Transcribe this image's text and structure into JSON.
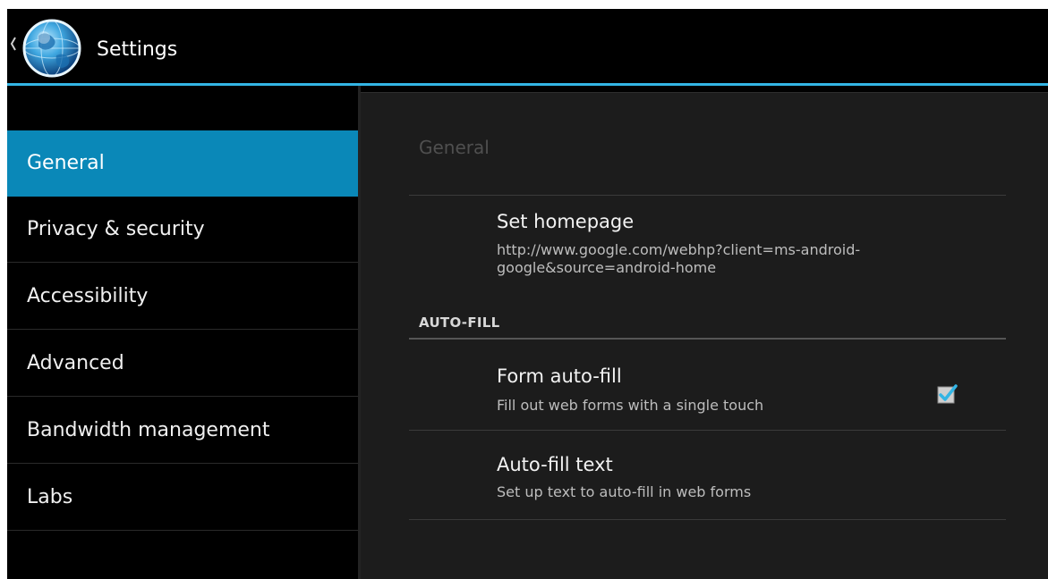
{
  "action_bar": {
    "title": "Settings",
    "up_icon": "chevron-left-icon",
    "app_icon": "globe-browser-icon",
    "accent_color": "#33b5e5"
  },
  "sidebar": {
    "items": [
      {
        "label": "General",
        "selected": true
      },
      {
        "label": "Privacy & security",
        "selected": false
      },
      {
        "label": "Accessibility",
        "selected": false
      },
      {
        "label": "Advanced",
        "selected": false
      },
      {
        "label": "Bandwidth management",
        "selected": false
      },
      {
        "label": "Labs",
        "selected": false
      }
    ],
    "selected_color": "#0a88b8"
  },
  "main": {
    "section_title": "General",
    "preferences": {
      "homepage": {
        "title": "Set homepage",
        "summary": "http://www.google.com/webhp?client=ms-android-google&source=android-home"
      },
      "category_autofill": "AUTO-FILL",
      "form_autofill": {
        "title": "Form auto-fill",
        "summary": "Fill out web forms with a single touch",
        "checked": true
      },
      "autofill_text": {
        "title": "Auto-fill text",
        "summary": "Set up text to auto-fill in web forms"
      }
    }
  }
}
